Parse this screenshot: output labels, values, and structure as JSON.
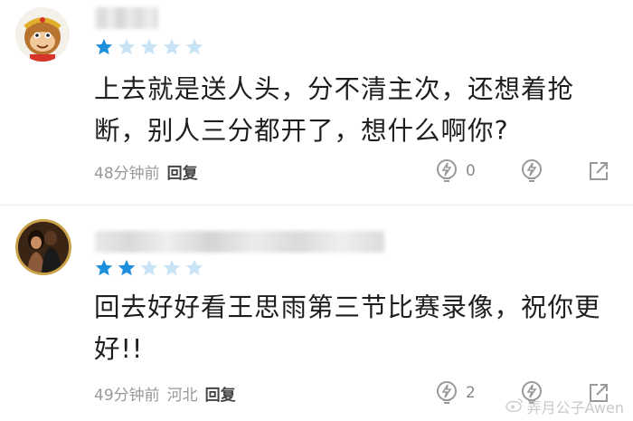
{
  "comments": [
    {
      "rating": 1,
      "rating_max": 5,
      "text_line1": "上去就是送人头，分不清主次，还想着抢",
      "text_line2": "断，别人三分都开了，想什么啊你?",
      "time": "48分钟前",
      "location": "",
      "reply_label": "回复",
      "like_count": "0"
    },
    {
      "rating": 2,
      "rating_max": 5,
      "text_line1": "回去好好看王思雨第三节比赛录像，祝你更",
      "text_line2": "好!!",
      "time": "49分钟前",
      "location": "河北",
      "reply_label": "回复",
      "like_count": "2"
    }
  ],
  "watermark": "弄月公子Awen",
  "colors": {
    "star_filled": "#1e8fdc",
    "star_empty": "#c8e3f5",
    "meta": "#999999"
  }
}
